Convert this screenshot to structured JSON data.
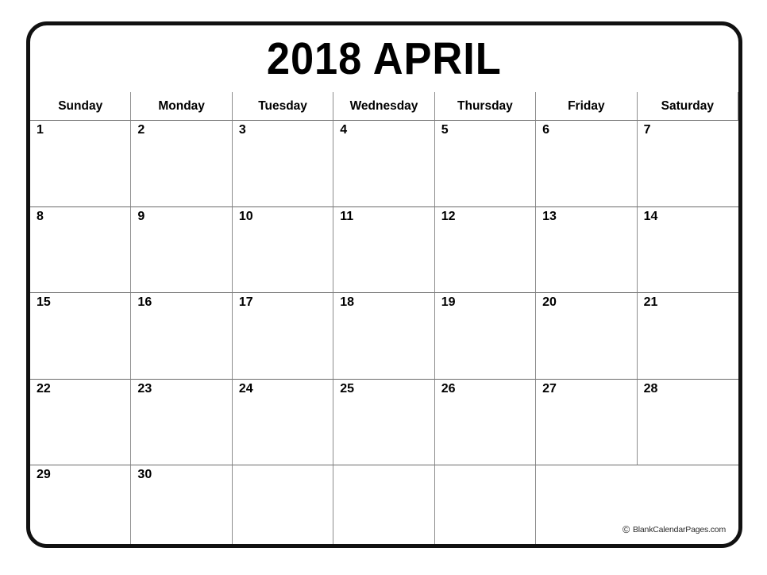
{
  "calendar": {
    "title": "2018 APRIL",
    "year": 2018,
    "month": "APRIL",
    "weekday_headers": [
      "Sunday",
      "Monday",
      "Tuesday",
      "Wednesday",
      "Thursday",
      "Friday",
      "Saturday"
    ],
    "weeks": [
      [
        "1",
        "2",
        "3",
        "4",
        "5",
        "6",
        "7"
      ],
      [
        "8",
        "9",
        "10",
        "11",
        "12",
        "13",
        "14"
      ],
      [
        "15",
        "16",
        "17",
        "18",
        "19",
        "20",
        "21"
      ],
      [
        "22",
        "23",
        "24",
        "25",
        "26",
        "27",
        "28"
      ],
      [
        "29",
        "30",
        "",
        "",
        "",
        "",
        ""
      ]
    ]
  },
  "footer": {
    "copyright_symbol": "©",
    "credit_text": "BlankCalendarPages.com"
  },
  "colors": {
    "frame_border": "#111111",
    "grid_line": "#8d8d8d",
    "grid_line_strong": "#6b6b6b",
    "text": "#000000",
    "background": "#ffffff"
  }
}
